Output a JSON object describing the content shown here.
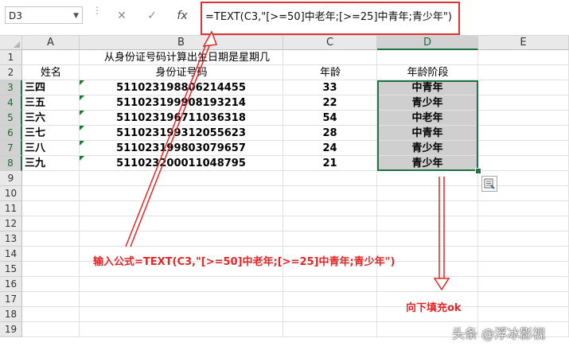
{
  "formula_bar": {
    "name_box": "D3",
    "cancel_glyph": "✕",
    "enter_glyph": "✓",
    "fx_label": "fx",
    "formula": "=TEXT(C3,\"[>=50]中老年;[>=25]中青年;青少年\")"
  },
  "columns": [
    "A",
    "B",
    "C",
    "D",
    "E"
  ],
  "rows": [
    "1",
    "2",
    "3",
    "4",
    "5",
    "6",
    "7",
    "8",
    "9",
    "10",
    "11",
    "12",
    "13",
    "14",
    "15",
    "16",
    "17",
    "18",
    "19"
  ],
  "sheet": {
    "title": "从身份证号码计算出生日期是星期几",
    "headers": {
      "name": "姓名",
      "id": "身份证号码",
      "age": "年龄",
      "group": "年龄阶段"
    },
    "records": [
      {
        "name": "三四",
        "id": "511023198806214455",
        "age": "33",
        "group": "中青年"
      },
      {
        "name": "三五",
        "id": "511023199908193214",
        "age": "22",
        "group": "青少年"
      },
      {
        "name": "三六",
        "id": "511023196711036318",
        "age": "54",
        "group": "中老年"
      },
      {
        "name": "三七",
        "id": "511023199312055623",
        "age": "28",
        "group": "中青年"
      },
      {
        "name": "三八",
        "id": "511023199803079657",
        "age": "24",
        "group": "青少年"
      },
      {
        "name": "三九",
        "id": "511023200011048795",
        "age": "21",
        "group": "青少年"
      }
    ]
  },
  "annotations": {
    "formula_note": "输入公式=TEXT(C3,\"[>=50]中老年;[>=25]中青年;青少年\")",
    "fill_note": "向下填充ok",
    "accent_color": "#e32626"
  },
  "watermark": "头条 @浮冰影视",
  "selection_color": "#217346"
}
